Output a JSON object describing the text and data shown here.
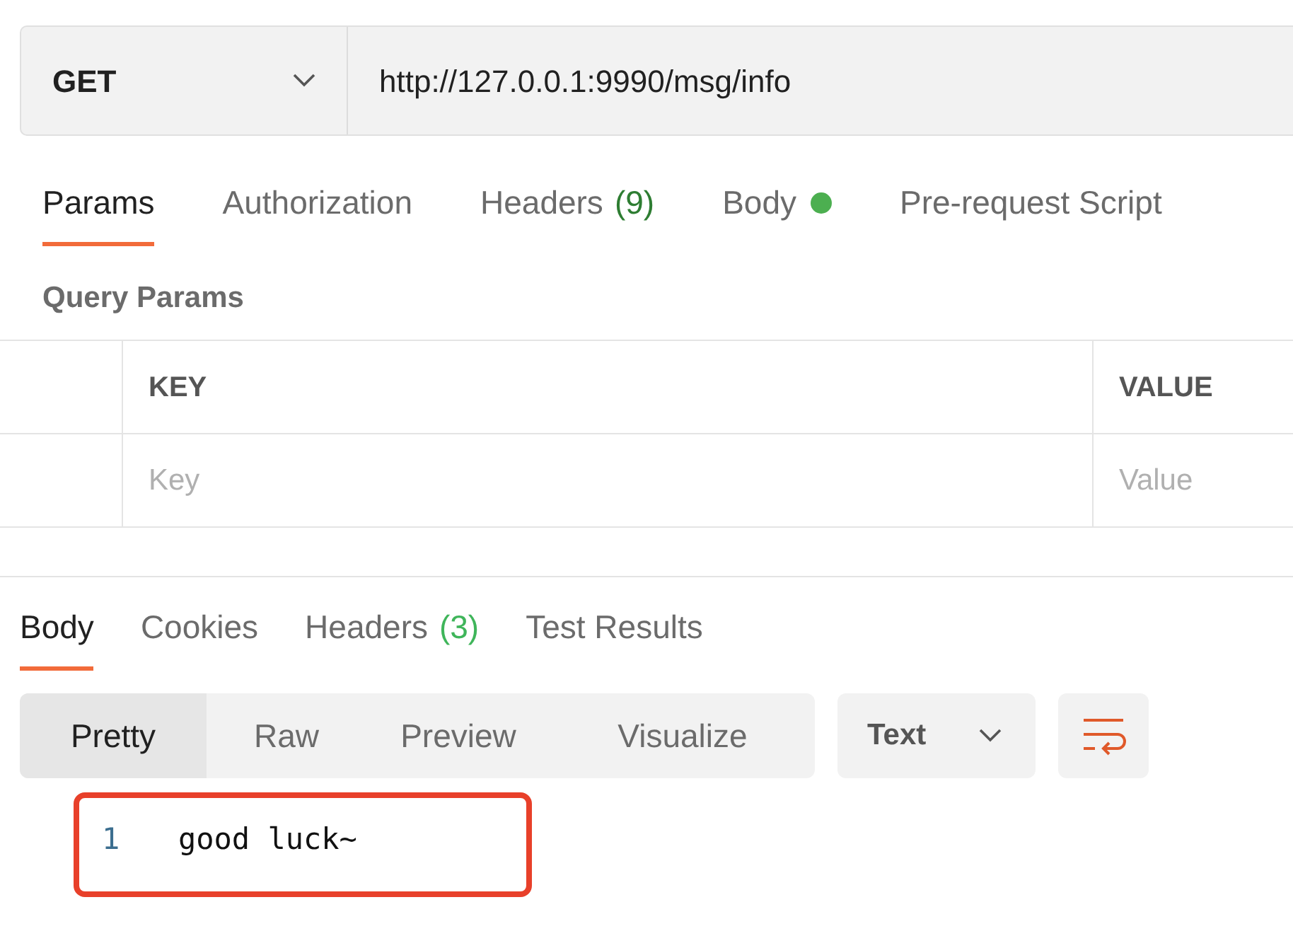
{
  "request": {
    "method": "GET",
    "url": "http://127.0.0.1:9990/msg/info"
  },
  "request_tabs": [
    {
      "label": "Params",
      "selected": true
    },
    {
      "label": "Authorization",
      "selected": false
    },
    {
      "label": "Headers",
      "count": "(9)",
      "selected": false
    },
    {
      "label": "Body",
      "has_content": true,
      "selected": false
    },
    {
      "label": "Pre-request Script",
      "selected": false
    }
  ],
  "query_params": {
    "title": "Query Params",
    "columns": [
      "KEY",
      "VALUE"
    ],
    "placeholders": [
      "Key",
      "Value"
    ]
  },
  "response_tabs": [
    {
      "label": "Body",
      "selected": true
    },
    {
      "label": "Cookies",
      "selected": false
    },
    {
      "label": "Headers",
      "count": "(3)",
      "selected": false
    },
    {
      "label": "Test Results",
      "selected": false
    }
  ],
  "view_modes": [
    {
      "label": "Pretty",
      "selected": true
    },
    {
      "label": "Raw",
      "selected": false
    },
    {
      "label": "Preview",
      "selected": false
    },
    {
      "label": "Visualize",
      "selected": false
    }
  ],
  "format": "Text",
  "response_lines": [
    {
      "number": "1",
      "text": "good luck~"
    }
  ],
  "highlight": true
}
